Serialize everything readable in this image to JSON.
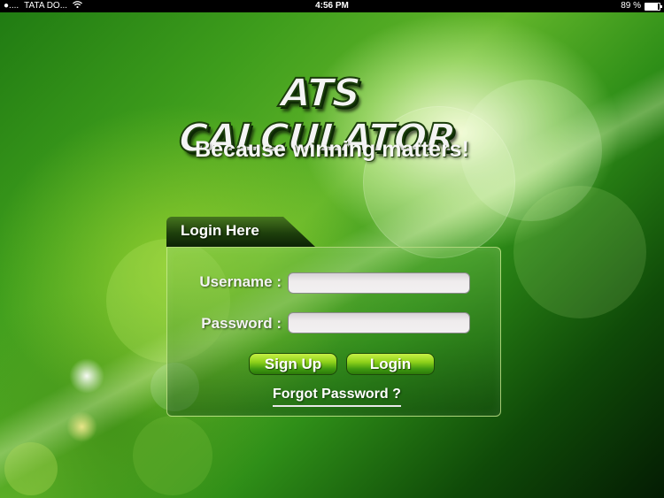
{
  "status_bar": {
    "carrier": "TATA DO...",
    "time": "4:56 PM",
    "battery_percent": "89 %",
    "battery_level": 0.89,
    "signal_icon": "signal-dots-icon",
    "wifi_icon": "wifi-icon",
    "battery_icon": "battery-icon"
  },
  "branding": {
    "logo_text": "ATS CALCULATOR",
    "tagline": "Because winning matters!"
  },
  "login": {
    "tab_label": "Login Here",
    "username_label": "Username :",
    "password_label": "Password :",
    "username_value": "",
    "password_value": "",
    "signup_label": "Sign Up",
    "login_label": "Login",
    "forgot_label": "Forgot Password ?"
  },
  "colors": {
    "background_green": "#3e9d1c",
    "button_green": "#8fd21b",
    "panel_border": "#d2f096",
    "text": "#ffffff"
  }
}
